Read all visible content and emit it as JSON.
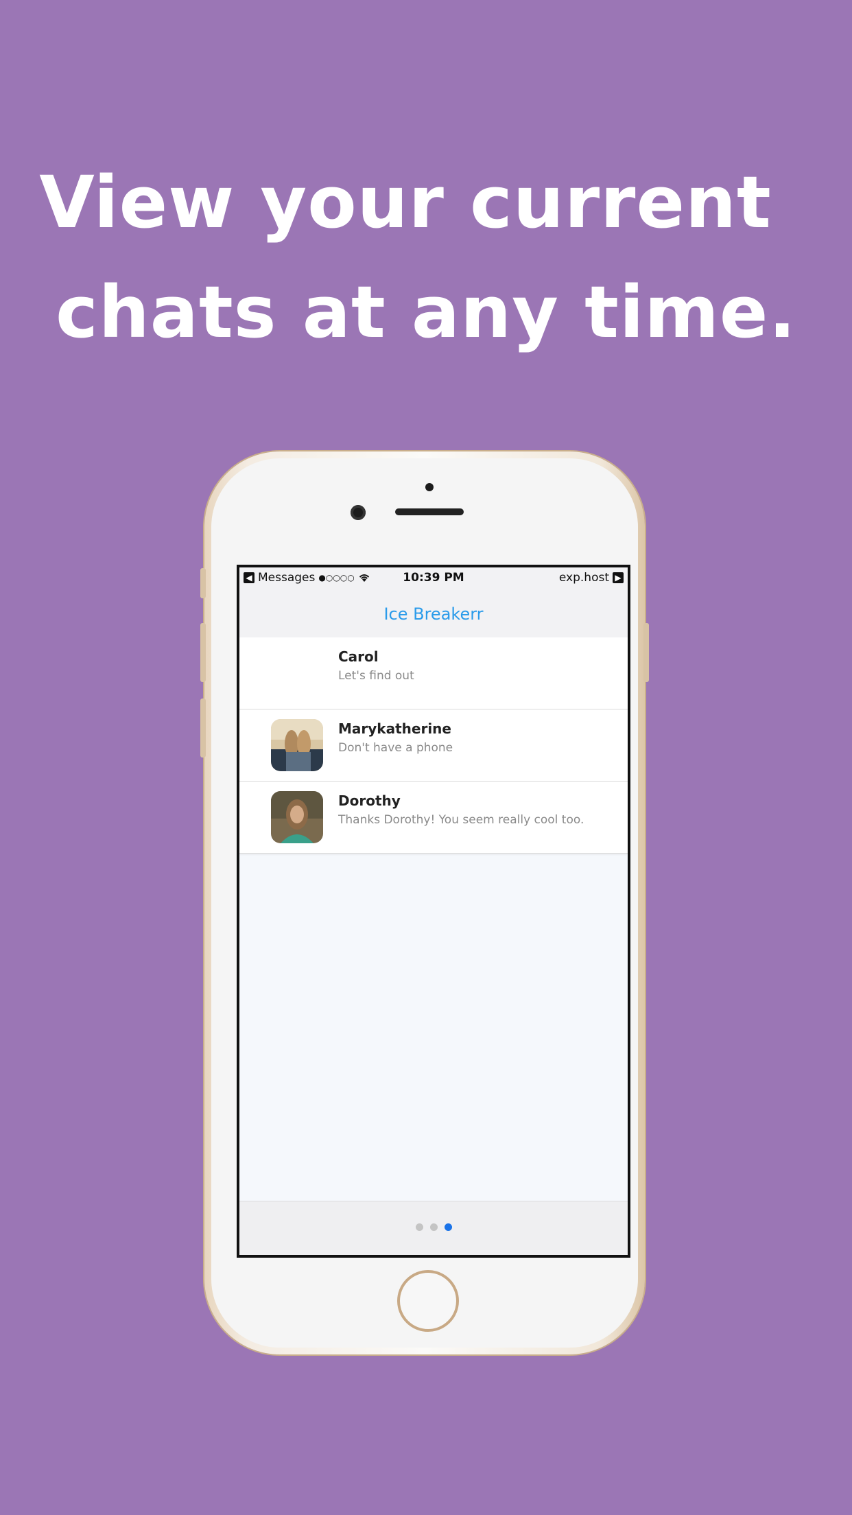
{
  "headline": {
    "line1": "View your current",
    "line2": "chats at any time."
  },
  "status_bar": {
    "back_app": "Messages",
    "signal": "●○○○○",
    "wifi_icon": "wifi-icon",
    "time": "10:39 PM",
    "carrier_host": "exp.host"
  },
  "nav": {
    "title": "Ice Breakerr"
  },
  "chats": [
    {
      "name": "Carol",
      "preview": "Let's find out",
      "has_avatar": false
    },
    {
      "name": "Marykatherine",
      "preview": "Don't have a phone",
      "has_avatar": true
    },
    {
      "name": "Dorothy",
      "preview": "Thanks Dorothy! You seem really cool too.",
      "has_avatar": true
    }
  ],
  "pager": {
    "pages": 3,
    "active": 3
  },
  "colors": {
    "background": "#9b76b5",
    "accent": "#2a9bea",
    "active_dot": "#1a73e8"
  }
}
